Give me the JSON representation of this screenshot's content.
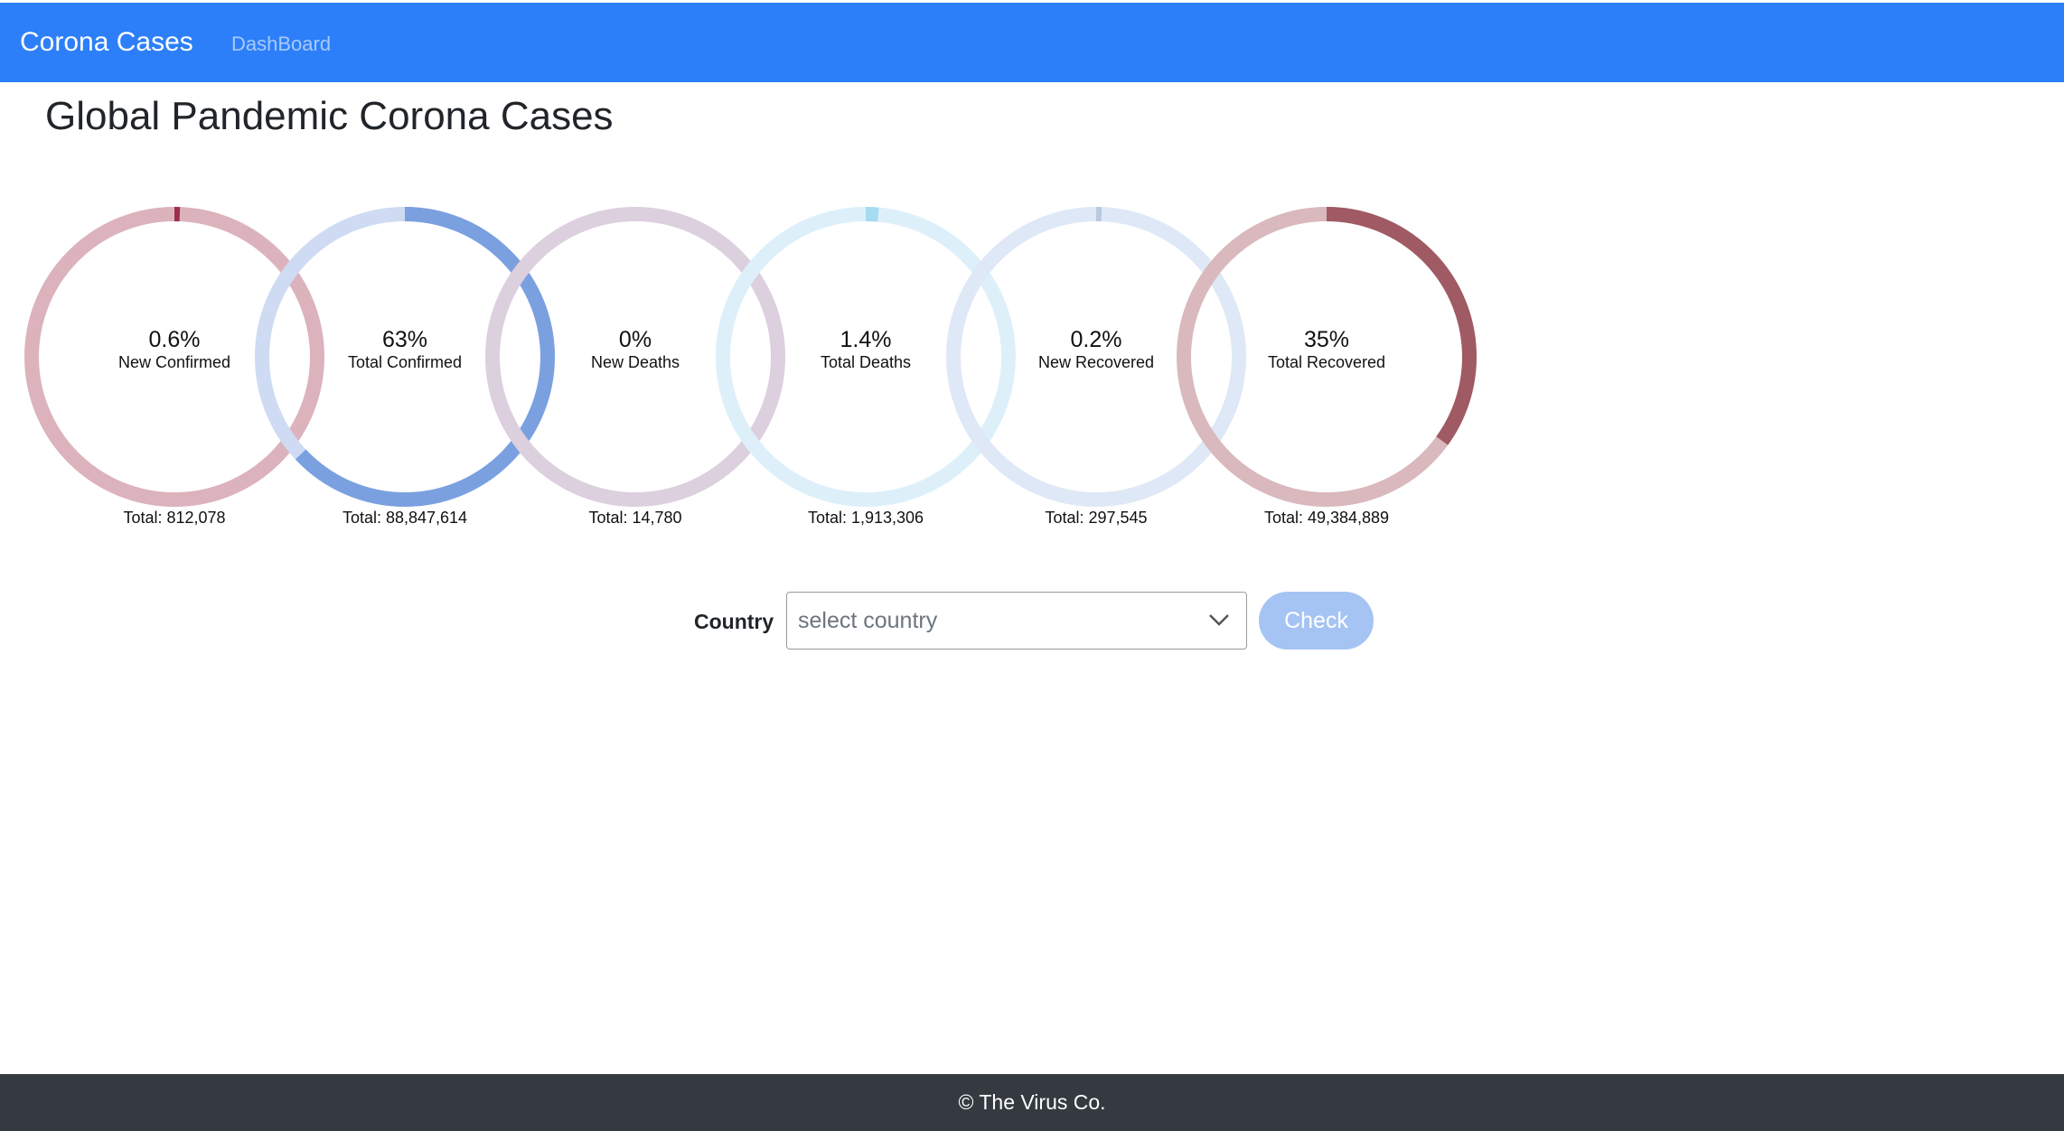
{
  "navbar": {
    "brand": "Corona Cases",
    "dashboard_link": "DashBoard"
  },
  "page_title": "Global Pandemic Corona Cases",
  "stats": [
    {
      "percent_label": "0.6%",
      "percent": 0.6,
      "label": "New Confirmed",
      "total": "Total: 812,078",
      "color": "#9e2f4c",
      "track_color": "#dcb3bd"
    },
    {
      "percent_label": "63%",
      "percent": 63,
      "label": "Total Confirmed",
      "total": "Total: 88,847,614",
      "color": "#7aa0e0",
      "track_color": "#cedbf3"
    },
    {
      "percent_label": "0%",
      "percent": 0,
      "label": "New Deaths",
      "total": "Total: 14,780",
      "color": "#8a6a96",
      "track_color": "#dccfde"
    },
    {
      "percent_label": "1.4%",
      "percent": 1.4,
      "label": "Total Deaths",
      "total": "Total: 1,913,306",
      "color": "#a6dcf2",
      "track_color": "#ddf0fa"
    },
    {
      "percent_label": "0.2%",
      "percent": 0.2,
      "label": "New Recovered",
      "total": "Total: 297,545",
      "color": "#b9c9e0",
      "track_color": "#dfe8f6"
    },
    {
      "percent_label": "35%",
      "percent": 35,
      "label": "Total Recovered",
      "total": "Total: 49,384,889",
      "color": "#a05a63",
      "track_color": "#d9b9bd"
    }
  ],
  "country_form": {
    "label": "Country",
    "placeholder": "select country",
    "button_label": "Check",
    "icon": "chevron-down-icon"
  },
  "footer": {
    "text": "© The Virus Co."
  }
}
